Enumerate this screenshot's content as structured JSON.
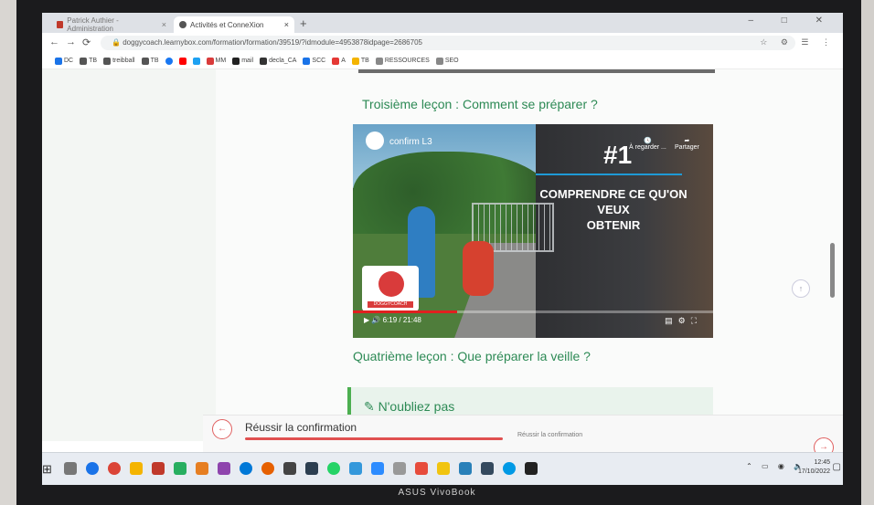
{
  "browser": {
    "tabs": [
      {
        "title": "Patrick Authier - Administration"
      },
      {
        "title": "Activités et ConneXion"
      }
    ],
    "new_tab": "+",
    "url": "doggycoach.learnybox.com/formation/formation/39519/?idmodule=4953878idpage=2686705"
  },
  "bookmarks": [
    "DC",
    "TB",
    "treibball",
    "TB",
    "MM",
    "mail",
    "decla_CA",
    "SCC",
    "A",
    "TB",
    "RESSOURCES",
    "SEO"
  ],
  "lesson3": {
    "title": "Troisième leçon : Comment se préparer ?"
  },
  "video": {
    "title": "confirm L3",
    "rank": "#1",
    "watch_later": "À regarder ...",
    "share": "Partager",
    "overlay_text_1": "COMPRENDRE CE QU'ON VEUX",
    "overlay_text_2": "OBTENIR",
    "badge_text": "DOGGYCOACH",
    "time": "6:19 / 21:48",
    "progress_fraction": 0.29
  },
  "lesson4": {
    "title": "Quatrième leçon : Que préparer la veille ?"
  },
  "note": {
    "label": "N'oubliez pas"
  },
  "bottom_nav": {
    "current_label": "Réussir la confirmation",
    "next_label": "Réussir la confirmation",
    "prev_icon": "left-arrow-icon",
    "next_icon": "right-arrow-icon"
  },
  "taskbar": {
    "time": "12:45",
    "date": "17/10/2022"
  },
  "device": {
    "brand": "ASUS VivoBook"
  },
  "colors": {
    "accent_green": "#2d8a55",
    "accent_red": "#e05050",
    "youtube_red": "#e02020"
  }
}
